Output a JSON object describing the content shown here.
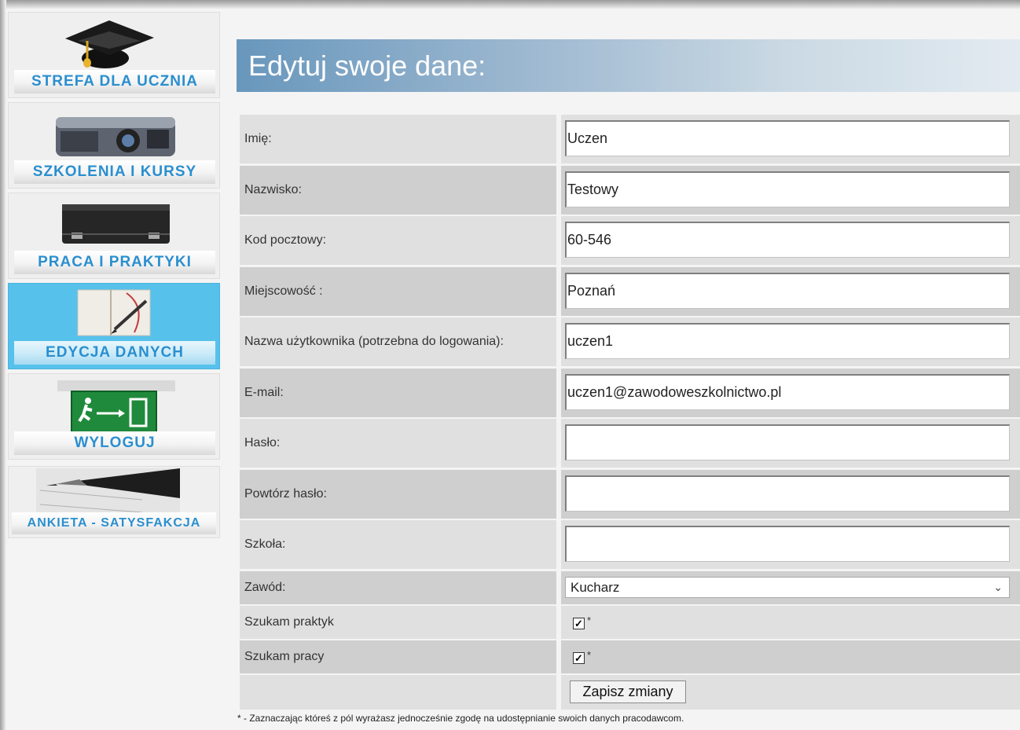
{
  "sidebar": {
    "items": [
      {
        "label": "STREFA DLA UCZNIA",
        "icon": "graduation-cap-icon"
      },
      {
        "label": "SZKOLENIA I KURSY",
        "icon": "projector-icon"
      },
      {
        "label": "PRACA I PRAKTYKI",
        "icon": "briefcase-icon"
      },
      {
        "label": "EDYCJA DANYCH",
        "icon": "notebook-pen-icon",
        "active": true
      },
      {
        "label": "WYLOGUJ",
        "icon": "exit-sign-icon"
      },
      {
        "label": "ANKIETA - SATYSFAKCJA",
        "icon": "pen-icon"
      }
    ]
  },
  "header": {
    "title": "Edytuj swoje dane:"
  },
  "form": {
    "fields": [
      {
        "label": "Imię:",
        "value": "Uczen"
      },
      {
        "label": "Nazwisko:",
        "value": "Testowy"
      },
      {
        "label": "Kod pocztowy:",
        "value": "60-546"
      },
      {
        "label": "Miejscowość :",
        "value": "Poznań"
      },
      {
        "label": "Nazwa użytkownika (potrzebna do logowania):",
        "value": "uczen1"
      },
      {
        "label": "E-mail:",
        "value": "uczen1@zawodoweszkolnictwo.pl"
      },
      {
        "label": "Hasło:",
        "value": ""
      },
      {
        "label": "Powtórz hasło:",
        "value": ""
      },
      {
        "label": "Szkoła:",
        "value": ""
      }
    ],
    "zawod": {
      "label": "Zawód:",
      "selected": "Kucharz"
    },
    "checkboxes": [
      {
        "label": "Szukam praktyk",
        "checked": true,
        "marker": "*"
      },
      {
        "label": "Szukam pracy",
        "checked": true,
        "marker": "*"
      }
    ],
    "save_label": "Zapisz zmiany"
  },
  "footnote": "* - Zaznaczając któreś z pól wyrażasz jednocześnie zgodę na udostępnianie swoich danych pracodawcom.",
  "colors": {
    "active_nav": "#56c1ea",
    "nav_text": "#2a8fcf",
    "header_start": "#6897bc"
  }
}
